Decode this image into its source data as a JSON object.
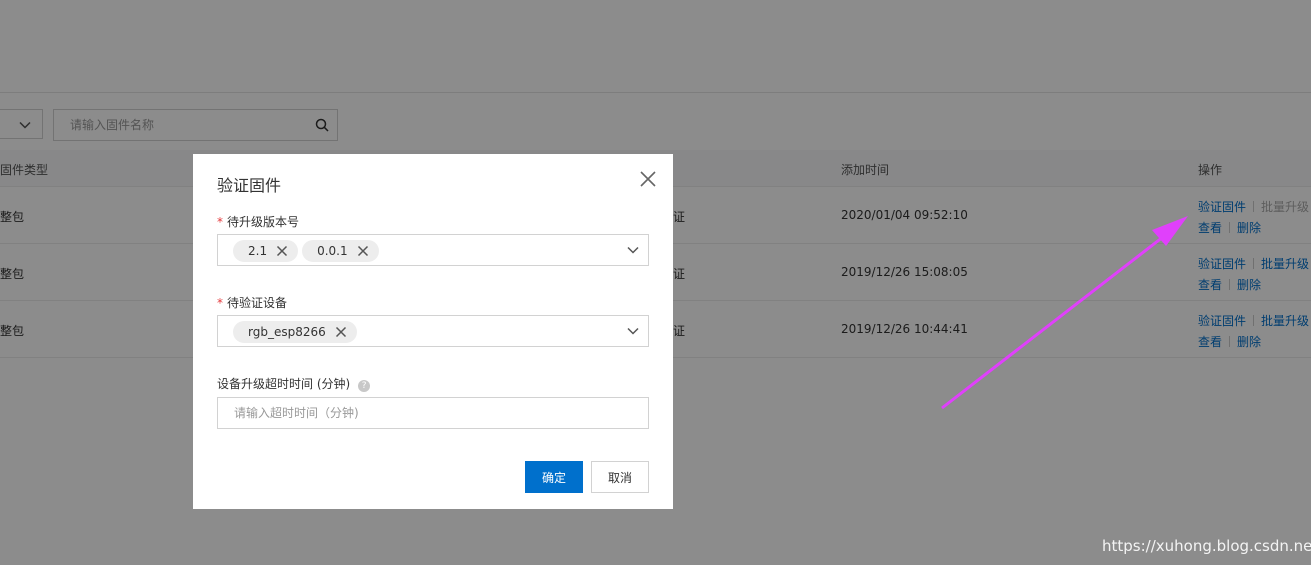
{
  "background": {
    "search": {
      "placeholder": "请输入固件名称",
      "value": ""
    },
    "columns": {
      "type": "固件类型",
      "added": "添加时间",
      "ops": "操作"
    },
    "rows": [
      {
        "type": "整包",
        "verify": "证",
        "added": "2020/01/04 09:52:10",
        "op_verify": "验证固件",
        "op_batch": "批量升级",
        "op_view": "查看",
        "op_delete": "删除",
        "batch_disabled": true
      },
      {
        "type": "整包",
        "verify": "证",
        "added": "2019/12/26 15:08:05",
        "op_verify": "验证固件",
        "op_batch": "批量升级",
        "op_view": "查看",
        "op_delete": "删除",
        "batch_disabled": false
      },
      {
        "type": "整包",
        "verify": "证",
        "added": "2019/12/26 10:44:41",
        "op_verify": "验证固件",
        "op_batch": "批量升级",
        "op_view": "查看",
        "op_delete": "删除",
        "batch_disabled": false
      }
    ]
  },
  "modal": {
    "title": "验证固件",
    "version_field": {
      "label": "待升级版本号",
      "tags": [
        "2.1",
        "0.0.1"
      ]
    },
    "device_field": {
      "label": "待验证设备",
      "tags": [
        "rgb_esp8266"
      ]
    },
    "timeout_field": {
      "label": "设备升级超时时间 (分钟)",
      "help_glyph": "?",
      "placeholder": "请输入超时时间（分钟)",
      "value": ""
    },
    "confirm_label": "确定",
    "cancel_label": "取消",
    "required_mark": "*"
  },
  "colors": {
    "primary": "#0070cc",
    "required": "#e4393c",
    "annotation_arrow": "#e040fb"
  },
  "watermark": "https://xuhong.blog.csdn.net"
}
